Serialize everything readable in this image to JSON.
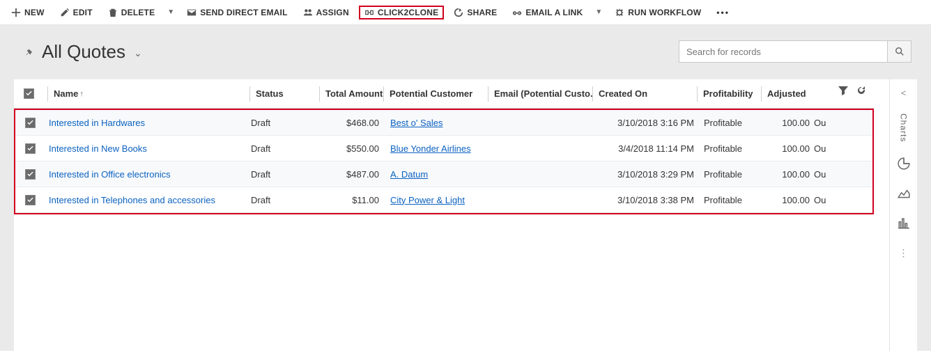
{
  "toolbar": {
    "new": "NEW",
    "edit": "EDIT",
    "delete": "DELETE",
    "send_email": "SEND DIRECT EMAIL",
    "assign": "ASSIGN",
    "click2clone": "CLICK2CLONE",
    "share": "SHARE",
    "email_link": "EMAIL A LINK",
    "run_workflow": "RUN WORKFLOW"
  },
  "header": {
    "title": "All Quotes",
    "search_placeholder": "Search for records"
  },
  "columns": {
    "name": "Name",
    "status": "Status",
    "amount": "Total Amount...",
    "customer": "Potential Customer",
    "email": "Email (Potential Custo...",
    "created": "Created On",
    "profitability": "Profitability",
    "adjusted": "Adjusted"
  },
  "rows": [
    {
      "name": "Interested in Hardwares",
      "status": "Draft",
      "amount": "$468.00",
      "customer": "Best o' Sales",
      "created": "3/10/2018 3:16 PM",
      "profitability": "Profitable",
      "adjusted": "100.00",
      "extra": "Ou"
    },
    {
      "name": "Interested in New Books",
      "status": "Draft",
      "amount": "$550.00",
      "customer": "Blue Yonder Airlines",
      "created": "3/4/2018 11:14 PM",
      "profitability": "Profitable",
      "adjusted": "100.00",
      "extra": "Ou"
    },
    {
      "name": "Interested in Office electronics",
      "status": "Draft",
      "amount": "$487.00",
      "customer": "A. Datum",
      "created": "3/10/2018 3:29 PM",
      "profitability": "Profitable",
      "adjusted": "100.00",
      "extra": "Ou"
    },
    {
      "name": "Interested in Telephones and accessories",
      "status": "Draft",
      "amount": "$11.00",
      "customer": "City Power & Light",
      "created": "3/10/2018 3:38 PM",
      "profitability": "Profitable",
      "adjusted": "100.00",
      "extra": "Ou"
    }
  ],
  "rail": {
    "charts": "Charts"
  }
}
